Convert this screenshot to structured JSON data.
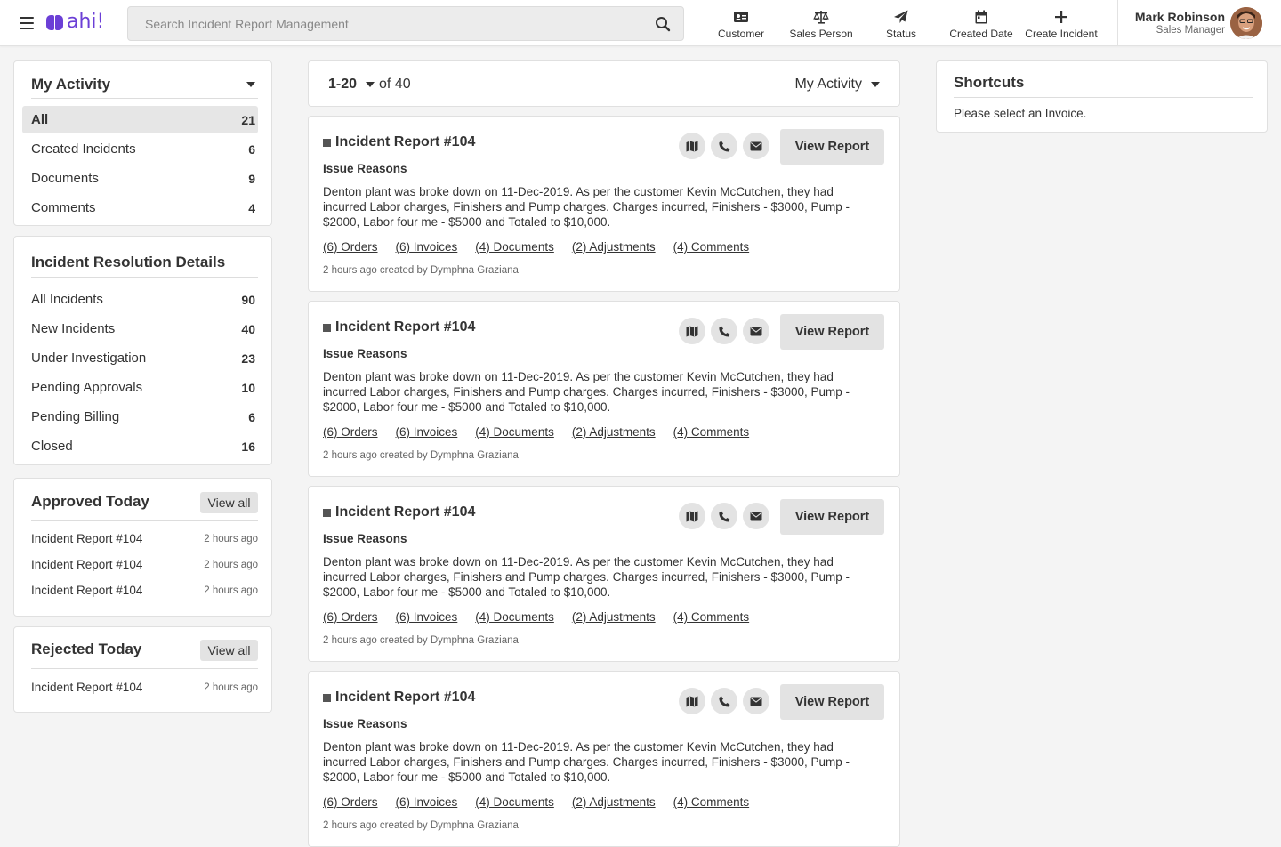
{
  "header": {
    "logo_text": "ahi!",
    "search_placeholder": "Search Incident Report Management",
    "nav": [
      {
        "label": "Customer",
        "icon": "id-card-icon"
      },
      {
        "label": "Sales Person",
        "icon": "balance-scale-icon"
      },
      {
        "label": "Status",
        "icon": "paper-plane-icon"
      },
      {
        "label": "Created Date",
        "icon": "calendar-icon"
      },
      {
        "label": "Create Incident",
        "icon": "plus-icon"
      }
    ],
    "user": {
      "name": "Mark Robinson",
      "role": "Sales Manager"
    }
  },
  "my_activity": {
    "title": "My Activity",
    "items": [
      {
        "label": "All",
        "count": "21"
      },
      {
        "label": "Created Incidents",
        "count": "6"
      },
      {
        "label": "Documents",
        "count": "9"
      },
      {
        "label": "Comments",
        "count": "4"
      }
    ]
  },
  "resolution": {
    "title": "Incident Resolution Details",
    "items": [
      {
        "label": "All Incidents",
        "count": "90"
      },
      {
        "label": "New Incidents",
        "count": "40"
      },
      {
        "label": "Under Investigation",
        "count": "23"
      },
      {
        "label": "Pending Approvals",
        "count": "10"
      },
      {
        "label": "Pending Billing",
        "count": "6"
      },
      {
        "label": "Closed",
        "count": "16"
      }
    ]
  },
  "approved_today": {
    "title": "Approved Today",
    "view_all": "View all",
    "items": [
      {
        "label": "Incident Report #104",
        "time": "2 hours ago"
      },
      {
        "label": "Incident Report #104",
        "time": "2 hours ago"
      },
      {
        "label": "Incident Report #104",
        "time": "2 hours ago"
      }
    ]
  },
  "rejected_today": {
    "title": "Rejected Today",
    "view_all": "View all",
    "items": [
      {
        "label": "Incident Report #104",
        "time": "2 hours ago"
      }
    ]
  },
  "pager": {
    "range": "1-20",
    "of": "of 40",
    "filter": "My Activity"
  },
  "reports": [
    {
      "title": "Incident Report #104",
      "button": "View Report",
      "subtitle": "Issue Reasons",
      "description": "Denton plant was broke down on 11-Dec-2019. As per the customer Kevin McCutchen, they had incurred Labor charges, Finishers and Pump charges. Charges incurred, Finishers - $3000, Pump - $2000, Labor four me - $5000 and Totaled to $10,000.",
      "links": [
        "(6) Orders",
        "(6) Invoices",
        "(4) Documents",
        "(2) Adjustments",
        "(4) Comments"
      ],
      "meta": "2 hours ago created by Dymphna Graziana"
    },
    {
      "title": "Incident Report #104",
      "button": "View Report",
      "subtitle": "Issue Reasons",
      "description": "Denton plant was broke down on 11-Dec-2019. As per the customer Kevin McCutchen, they had incurred Labor charges, Finishers and Pump charges. Charges incurred, Finishers - $3000, Pump - $2000, Labor four me - $5000 and Totaled to $10,000.",
      "links": [
        "(6) Orders",
        "(6) Invoices",
        "(4) Documents",
        "(2) Adjustments",
        "(4) Comments"
      ],
      "meta": "2 hours ago created by Dymphna Graziana"
    },
    {
      "title": "Incident Report #104",
      "button": "View Report",
      "subtitle": "Issue Reasons",
      "description": "Denton plant was broke down on 11-Dec-2019. As per the customer Kevin McCutchen, they had incurred Labor charges, Finishers and Pump charges. Charges incurred, Finishers - $3000, Pump - $2000, Labor four me - $5000 and Totaled to $10,000.",
      "links": [
        "(6) Orders",
        "(6) Invoices",
        "(4) Documents",
        "(2) Adjustments",
        "(4) Comments"
      ],
      "meta": "2 hours ago created by Dymphna Graziana"
    },
    {
      "title": "Incident Report #104",
      "button": "View Report",
      "subtitle": "Issue Reasons",
      "description": "Denton plant was broke down on 11-Dec-2019. As per the customer Kevin McCutchen, they had incurred Labor charges, Finishers and Pump charges. Charges incurred, Finishers - $3000, Pump - $2000, Labor four me - $5000 and Totaled to $10,000.",
      "links": [
        "(6) Orders",
        "(6) Invoices",
        "(4) Documents",
        "(2) Adjustments",
        "(4) Comments"
      ],
      "meta": "2 hours ago created by Dymphna Graziana"
    }
  ],
  "shortcuts": {
    "title": "Shortcuts",
    "text": "Please select an Invoice."
  },
  "colors": {
    "brand": "#6b3fd6",
    "background": "#f4f4f4",
    "button": "#e3e3e3"
  }
}
